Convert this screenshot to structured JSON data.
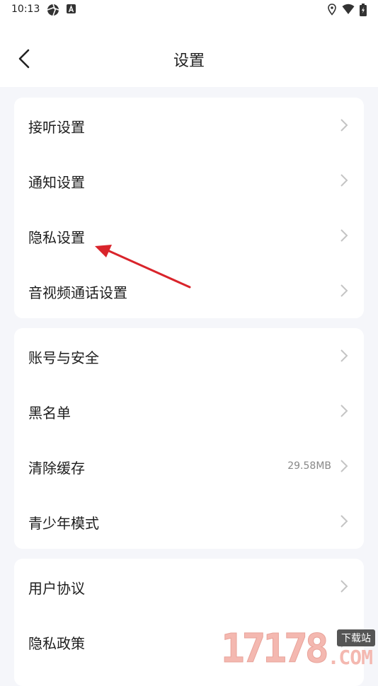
{
  "status_bar": {
    "time": "10:13",
    "icons": [
      "aperture-icon",
      "a-box-icon",
      "location-icon",
      "wifi-icon",
      "battery-icon"
    ]
  },
  "header": {
    "title": "设置",
    "back_icon": "chevron-left-icon"
  },
  "groups": [
    {
      "items": [
        {
          "label": "接听设置"
        },
        {
          "label": "通知设置"
        },
        {
          "label": "隐私设置"
        },
        {
          "label": "音视频通话设置"
        }
      ]
    },
    {
      "items": [
        {
          "label": "账号与安全"
        },
        {
          "label": "黑名单"
        },
        {
          "label": "清除缓存",
          "value": "29.58MB"
        },
        {
          "label": "青少年模式"
        }
      ]
    },
    {
      "items": [
        {
          "label": "用户协议"
        },
        {
          "label": "隐私政策"
        }
      ]
    }
  ],
  "annotation": {
    "color": "#d9242b",
    "icon": "red-arrow"
  },
  "watermark": {
    "digits": "17178",
    "tag": "下载站",
    "suffix": ".COM"
  },
  "colors": {
    "background": "#f5f6fa",
    "card": "#ffffff",
    "chevron": "#c4c4c4"
  }
}
